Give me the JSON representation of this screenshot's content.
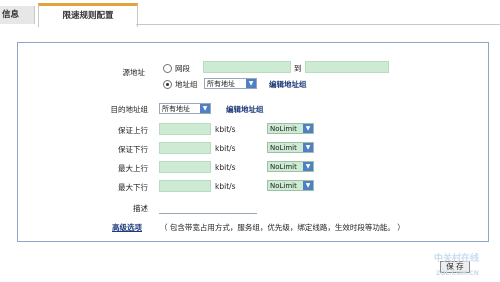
{
  "tabs": [
    {
      "label": "信息"
    },
    {
      "label": "限速规则配置"
    }
  ],
  "form": {
    "source_label": "源地址",
    "source_option_segment": "网段",
    "source_to_label": "到",
    "source_option_group": "地址组",
    "source_group_value": "所有地址",
    "edit_group_link_1": "编辑地址组",
    "dest_label": "目的地址组",
    "dest_group_value": "所有地址",
    "edit_group_link_2": "编辑地址组",
    "rows": [
      {
        "label": "保证上行",
        "unit": "kbit/s",
        "select": "NoLimit"
      },
      {
        "label": "保证下行",
        "unit": "kbit/s",
        "select": "NoLimit"
      },
      {
        "label": "最大上行",
        "unit": "kbit/s",
        "select": "NoLimit"
      },
      {
        "label": "最大下行",
        "unit": "kbit/s",
        "select": "NoLimit"
      }
    ],
    "desc_label": "描述",
    "advanced_link": "高级选项",
    "advanced_hint": "（ 包含带宽占用方式，服务组，优先级，绑定线路，生效时段等功能。 ）",
    "save_button": "保 存"
  },
  "watermark": {
    "text": "中关村在线",
    "sub": "ZOL.COM.CN"
  },
  "colors": {
    "accent": "#e2a33d",
    "border": "#8ea7c6",
    "input_bg": "#cdebd3",
    "link": "#1f3a7a"
  }
}
